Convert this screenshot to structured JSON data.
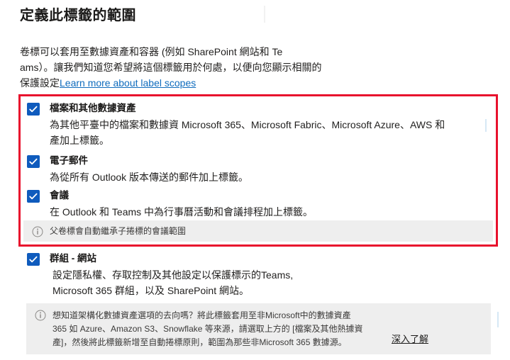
{
  "page": {
    "title": "定義此標籤的範圍"
  },
  "intro": {
    "line1": "卷標可以套用至數據資產和容器 (例如 SharePoint 網站和 Te",
    "line2": "ams）。讓我們知道您希望將這個標籤用於何處，以便向您顯示相關的",
    "line3_prefix": "保護設定",
    "link_label": "Learn more about label scopes"
  },
  "scopes": [
    {
      "id": "files-and-other-data-assets",
      "checked": true,
      "title": "檔案和其他數據資產",
      "desc_lines": [
        "為其他平臺中的檔案和數據資  Microsoft 365、Microsoft Fabric、Microsoft Azure、AWS 和",
        "產加上標籤。"
      ]
    },
    {
      "id": "email",
      "checked": true,
      "title": "電子郵件",
      "desc_lines": [
        "為從所有 Outlook 版本傳送的郵件加上標籤。"
      ]
    },
    {
      "id": "meetings",
      "checked": true,
      "title": "會議",
      "desc_lines": [
        "在 Outlook 和 Teams 中為行事曆活動和會議排程加上標籤。"
      ]
    },
    {
      "id": "groups-and-sites",
      "checked": true,
      "title": "群組 - 網站",
      "desc_lines": [
        "設定隱私權、存取控制及其他設定以保護標示的Teams,",
        "Microsoft 365 群組，以及          SharePoint 網站。"
      ]
    }
  ],
  "info_meeting": {
    "icon": "info-icon",
    "text": "父卷標會自動繼承子捲標的會議範圍"
  },
  "info_structured": {
    "icon": "info-icon",
    "lines": [
      "想知道架構化數據資產選項的去向嗎？將此標籤套用至非Microsoft中的數據資產",
      "365 如 Azure、Amazon S3、Snowflake 等來源，請選取上方的 [檔案及其他熱據資",
      "產]，然後將此標籤新增至自動捲標原則，範圍為那些非Microsoft 365 數據源。"
    ],
    "learn_more": "深入了解"
  },
  "colors": {
    "highlight_border": "#e8112d",
    "checkbox_fill": "#0f5bbd",
    "link": "#0f6cbd",
    "infobar_bg": "#eeeeee"
  }
}
